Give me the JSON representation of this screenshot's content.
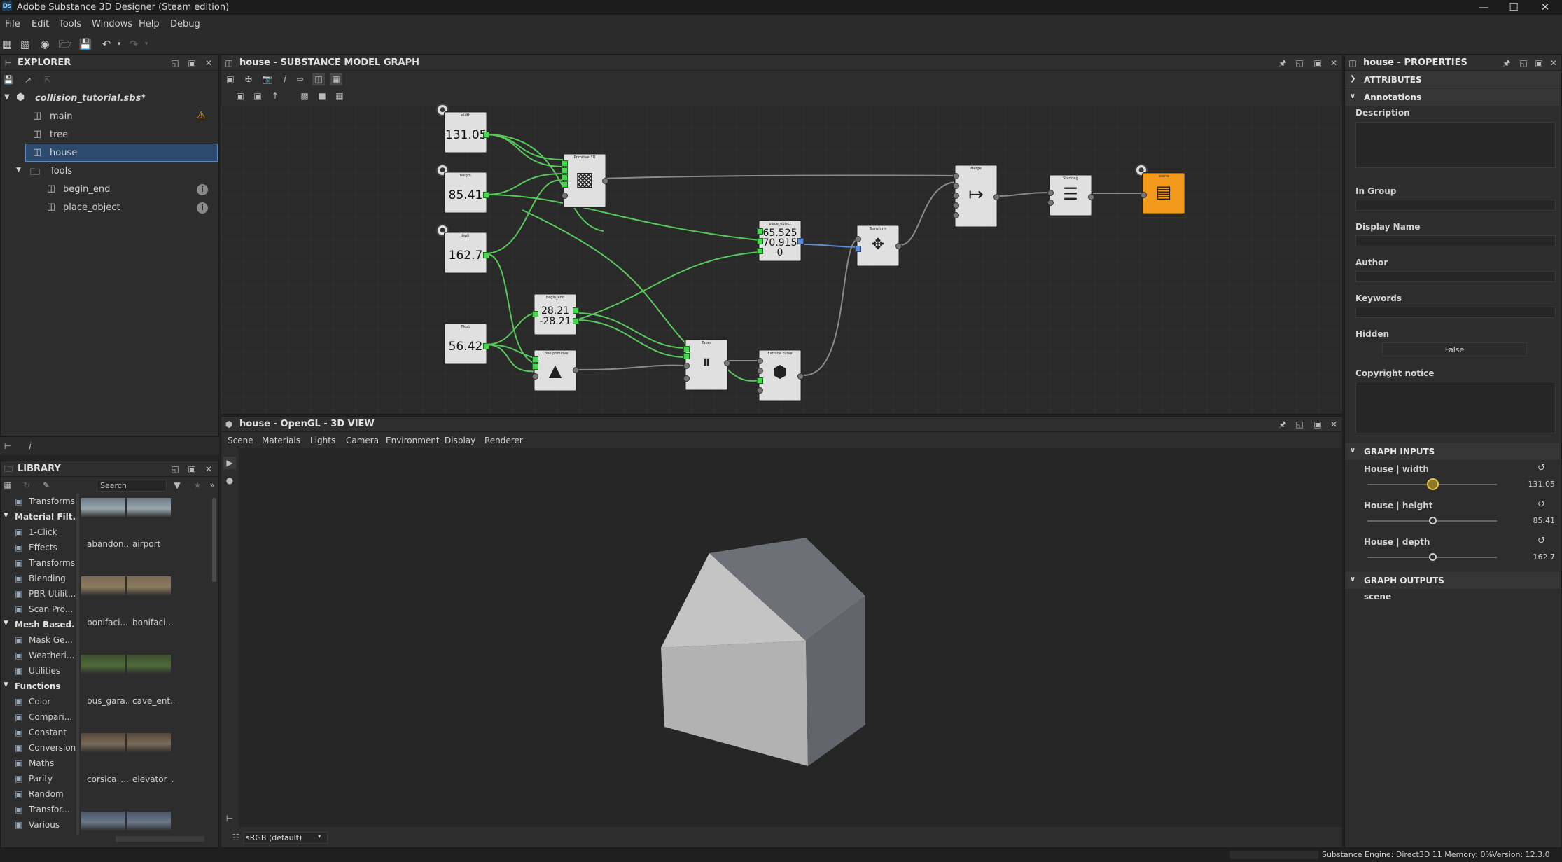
{
  "app": {
    "title": "Adobe Substance 3D Designer (Steam edition)",
    "logo": "Ds"
  },
  "menu": [
    "File",
    "Edit",
    "Tools",
    "Windows",
    "Help",
    "Debug"
  ],
  "explorer": {
    "title": "EXPLORER",
    "package": "collision_tutorial.sbs*",
    "items": [
      {
        "label": "main"
      },
      {
        "label": "tree"
      },
      {
        "label": "house"
      },
      {
        "label": "Tools"
      },
      {
        "label": "begin_end"
      },
      {
        "label": "place_object"
      }
    ]
  },
  "graph": {
    "title": "house - SUBSTANCE MODEL GRAPH",
    "nodes": {
      "width": {
        "label": "width",
        "value": "131.05"
      },
      "height": {
        "label": "height",
        "value": "85.41"
      },
      "depth": {
        "label": "depth",
        "value": "162.7"
      },
      "float": {
        "label": "Float",
        "value": "56.42"
      },
      "primitive": {
        "label": "Primitive 3D"
      },
      "begin_end": {
        "label": "begin_end",
        "v1": "28.21",
        "v2": "-28.21"
      },
      "cone": {
        "label": "Cone primitive"
      },
      "place_object": {
        "label": "place_object",
        "v1": "65.525",
        "v2": "70.915",
        "v3": "0"
      },
      "taper": {
        "label": "Taper"
      },
      "extrude": {
        "label": "Extrude curve"
      },
      "transform": {
        "label": "Transform"
      },
      "merge": {
        "label": "Merge"
      },
      "stacking": {
        "label": "Stacking"
      },
      "scene": {
        "label": "scene"
      }
    }
  },
  "view3d": {
    "title": "house - OpenGL - 3D VIEW",
    "menu": [
      "Scene",
      "Materials",
      "Lights",
      "Camera",
      "Environment",
      "Display",
      "Renderer"
    ],
    "colorspace": "sRGB (default)"
  },
  "library": {
    "title": "LIBRARY",
    "search_placeholder": "Search",
    "tree": [
      {
        "label": "Transforms",
        "type": "item"
      },
      {
        "label": "Material Filt...",
        "type": "header"
      },
      {
        "label": "1-Click",
        "type": "item"
      },
      {
        "label": "Effects",
        "type": "item"
      },
      {
        "label": "Transforms",
        "type": "item"
      },
      {
        "label": "Blending",
        "type": "item"
      },
      {
        "label": "PBR Utilit...",
        "type": "item"
      },
      {
        "label": "Scan Pro...",
        "type": "item"
      },
      {
        "label": "Mesh Based...",
        "type": "header"
      },
      {
        "label": "Mask Ge...",
        "type": "item"
      },
      {
        "label": "Weatheri...",
        "type": "item"
      },
      {
        "label": "Utilities",
        "type": "item"
      },
      {
        "label": "Functions",
        "type": "header"
      },
      {
        "label": "Color",
        "type": "item"
      },
      {
        "label": "Compari...",
        "type": "item"
      },
      {
        "label": "Constant",
        "type": "item"
      },
      {
        "label": "Conversion",
        "type": "item"
      },
      {
        "label": "Maths",
        "type": "item"
      },
      {
        "label": "Parity",
        "type": "item"
      },
      {
        "label": "Random",
        "type": "item"
      },
      {
        "label": "Transfor...",
        "type": "item"
      },
      {
        "label": "Various",
        "type": "item"
      }
    ],
    "thumbs": [
      {
        "a": "abandon...",
        "b": "airport"
      },
      {
        "a": "bonifaci...",
        "b": "bonifaci..."
      },
      {
        "a": "bus_gara...",
        "b": "cave_ent..."
      },
      {
        "a": "corsica_...",
        "b": "elevator_..."
      },
      {
        "a": "",
        "b": ""
      }
    ]
  },
  "properties": {
    "title": "house - PROPERTIES",
    "attributes": "ATTRIBUTES",
    "annotations": "Annotations",
    "fields": {
      "description": "Description",
      "in_group": "In Group",
      "display_name": "Display Name",
      "author": "Author",
      "keywords": "Keywords",
      "hidden": "Hidden",
      "hidden_value": "False",
      "copyright": "Copyright notice"
    },
    "graph_inputs": "GRAPH INPUTS",
    "inputs": [
      {
        "label": "House | width",
        "value": "131.05",
        "fraction": 0.5
      },
      {
        "label": "House | height",
        "value": "85.41",
        "fraction": 0.5
      },
      {
        "label": "House | depth",
        "value": "162.7",
        "fraction": 0.5
      }
    ],
    "graph_outputs": "GRAPH OUTPUTS",
    "outputs": [
      "scene"
    ]
  },
  "status": {
    "engine": "Substance Engine: Direct3D 11  Memory: 0%",
    "version": "Version: 12.3.0"
  }
}
